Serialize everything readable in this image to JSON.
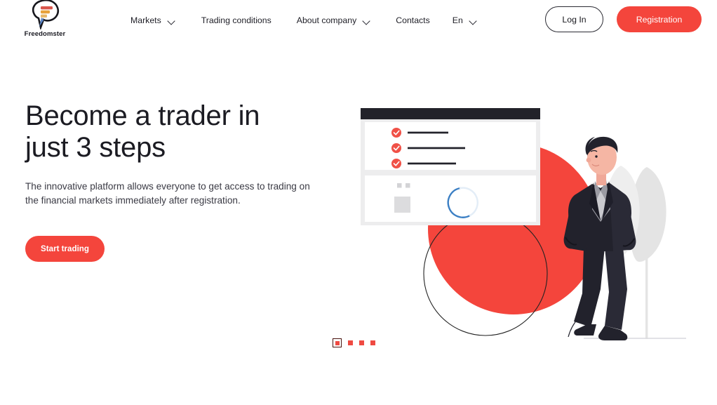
{
  "brand": {
    "name": "Freedomster",
    "logo_icon": "freedomster-logo-icon",
    "accent_color": "#f4453c",
    "logo_bar_colors": [
      "#e05a4a",
      "#f0a23c",
      "#4a86c8"
    ]
  },
  "nav": {
    "items": [
      {
        "label": "Markets",
        "has_dropdown": true,
        "icon": "chevron-down-icon"
      },
      {
        "label": "Trading conditions",
        "has_dropdown": false,
        "icon": ""
      },
      {
        "label": "About company",
        "has_dropdown": true,
        "icon": "chevron-down-icon"
      },
      {
        "label": "Contacts",
        "has_dropdown": false,
        "icon": ""
      },
      {
        "label": "En",
        "has_dropdown": true,
        "icon": "chevron-down-icon"
      }
    ]
  },
  "header_actions": {
    "login_label": "Log In",
    "register_label": "Registration"
  },
  "hero": {
    "title_line1": "Become a trader in",
    "title_line2": "just 3 steps",
    "subtitle": "The innovative platform allows everyone to get access to trading on the financial markets immediately after registration.",
    "cta_label": "Start trading"
  },
  "carousel": {
    "total_slides": 4,
    "active_index": 0,
    "dot_color": "#ef4a42"
  },
  "illustration": {
    "window_titlebar_color": "#22222a",
    "checklist_items": 3,
    "check_icon": "check-circle-icon",
    "spinner_icon": "loading-spinner-icon",
    "spinner_color": "#3b7fc4",
    "big_circle_color": "#f4453c",
    "person": "businessman-leaning-figure",
    "trees": 2,
    "ground_line_color": "#d9d9dd"
  }
}
